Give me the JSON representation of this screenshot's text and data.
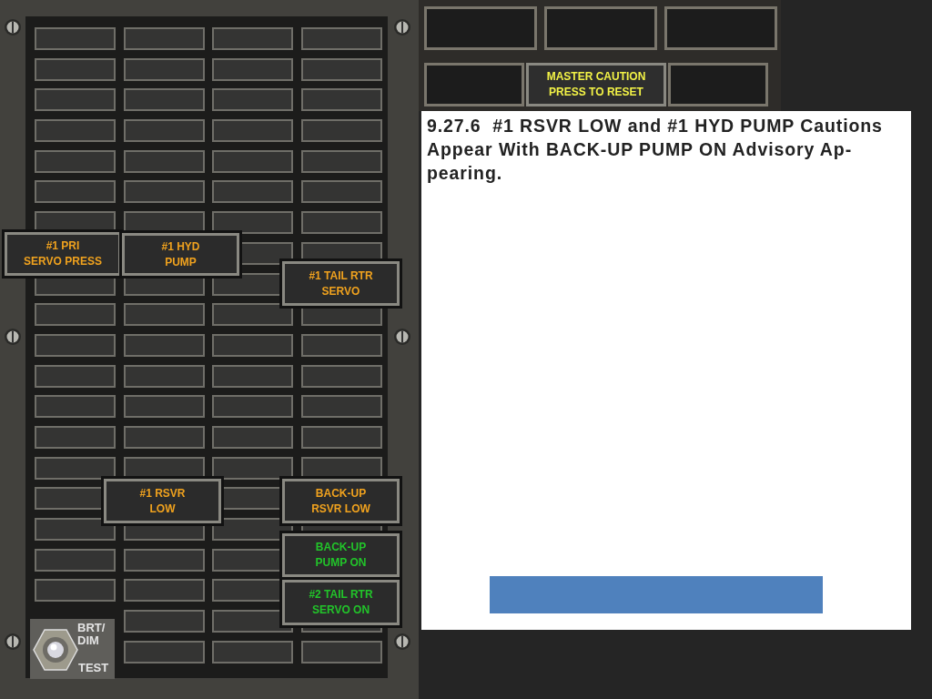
{
  "caution_panel": {
    "lit_legends": [
      {
        "lines": [
          "#1 PRI",
          "SERVO PRESS"
        ],
        "color": "#f0a21e"
      },
      {
        "lines": [
          "#1 HYD",
          "PUMP"
        ],
        "color": "#f0a21e"
      },
      {
        "lines": [
          "#1 TAIL RTR",
          "SERVO"
        ],
        "color": "#f0a21e"
      },
      {
        "lines": [
          "#1 RSVR",
          "LOW"
        ],
        "color": "#f0a21e"
      },
      {
        "lines": [
          "BACK-UP",
          "RSVR LOW"
        ],
        "color": "#f0a21e"
      },
      {
        "lines": [
          "BACK-UP",
          "PUMP ON"
        ],
        "color": "#22c42a"
      },
      {
        "lines": [
          "#2 TAIL RTR",
          "SERVO ON"
        ],
        "color": "#22c42a"
      }
    ],
    "switch": {
      "upper_label": [
        "BRT/",
        "DIM"
      ],
      "lower_label": "TEST"
    }
  },
  "master_caution": {
    "lines": [
      "MASTER CAUTION",
      "PRESS TO RESET"
    ]
  },
  "procedure": {
    "heading": "9.27.6  #1 RSVR LOW and #1 HYD PUMP Cautions Appear With BACK-UP PUMP ON Advisory Ap-pearing."
  }
}
